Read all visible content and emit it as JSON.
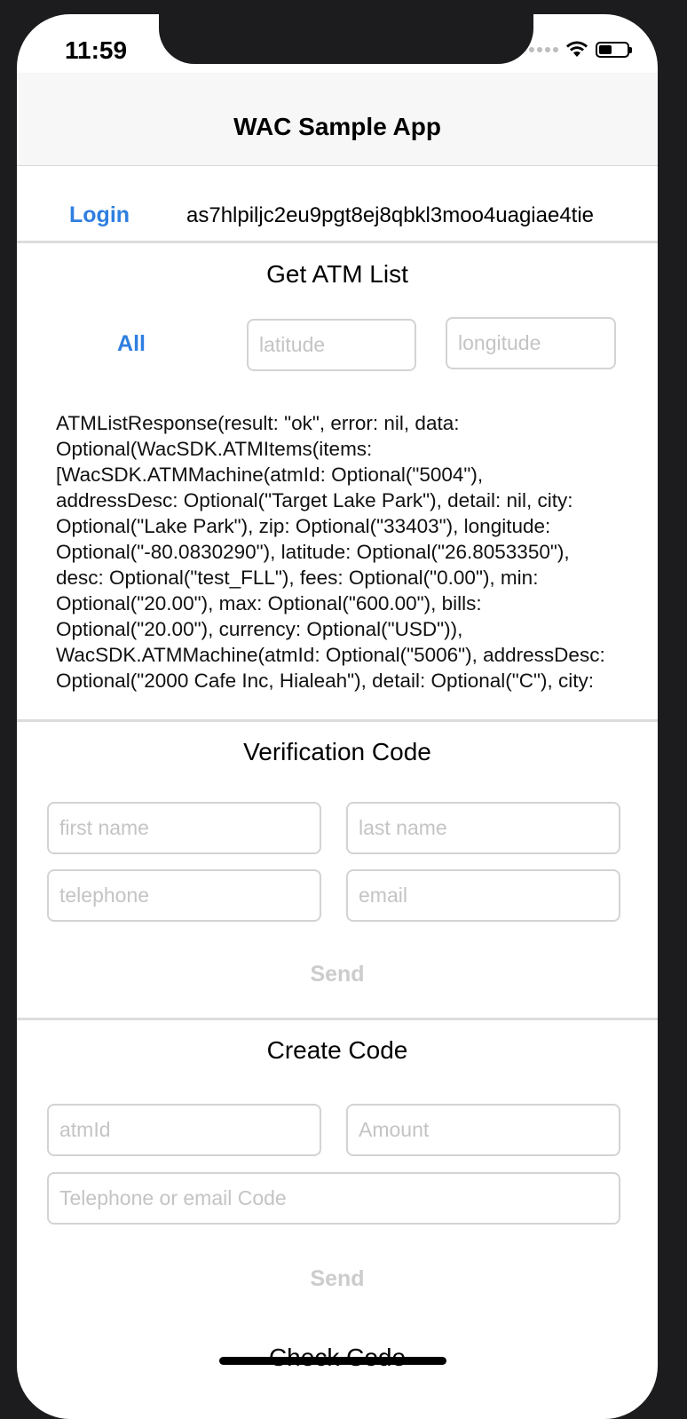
{
  "status_bar": {
    "time": "11:59",
    "battery_level": 0.45
  },
  "nav": {
    "title": "WAC Sample App"
  },
  "login": {
    "button_label": "Login",
    "token": "as7hlpiljc2eu9pgt8ej8qbkl3moo4uagiae4tie"
  },
  "atm_list": {
    "title": "Get ATM List",
    "all_label": "All",
    "latitude_placeholder": "latitude",
    "longitude_placeholder": "longitude",
    "response_text": "ATMListResponse(result: \"ok\", error: nil, data: Optional(WacSDK.ATMItems(items: [WacSDK.ATMMachine(atmId: Optional(\"5004\"), addressDesc: Optional(\"Target Lake Park\"), detail: nil, city: Optional(\"Lake Park\"), zip: Optional(\"33403\"), longitude: Optional(\"-80.0830290\"), latitude: Optional(\"26.8053350\"), desc: Optional(\"test_FLL\"), fees: Optional(\"0.00\"), min: Optional(\"20.00\"), max: Optional(\"600.00\"), bills: Optional(\"20.00\"), currency: Optional(\"USD\")), WacSDK.ATMMachine(atmId: Optional(\"5006\"), addressDesc: Optional(\"2000 Cafe Inc, Hialeah\"), detail: Optional(\"C\"), city:"
  },
  "verification": {
    "title": "Verification Code",
    "first_name_placeholder": "first name",
    "last_name_placeholder": "last name",
    "telephone_placeholder": "telephone",
    "email_placeholder": "email",
    "send_label": "Send"
  },
  "create_code": {
    "title": "Create Code",
    "atm_id_placeholder": "atmId",
    "amount_placeholder": "Amount",
    "contact_placeholder": "Telephone or email Code",
    "send_label": "Send"
  },
  "check_code": {
    "title": "Check Code"
  }
}
